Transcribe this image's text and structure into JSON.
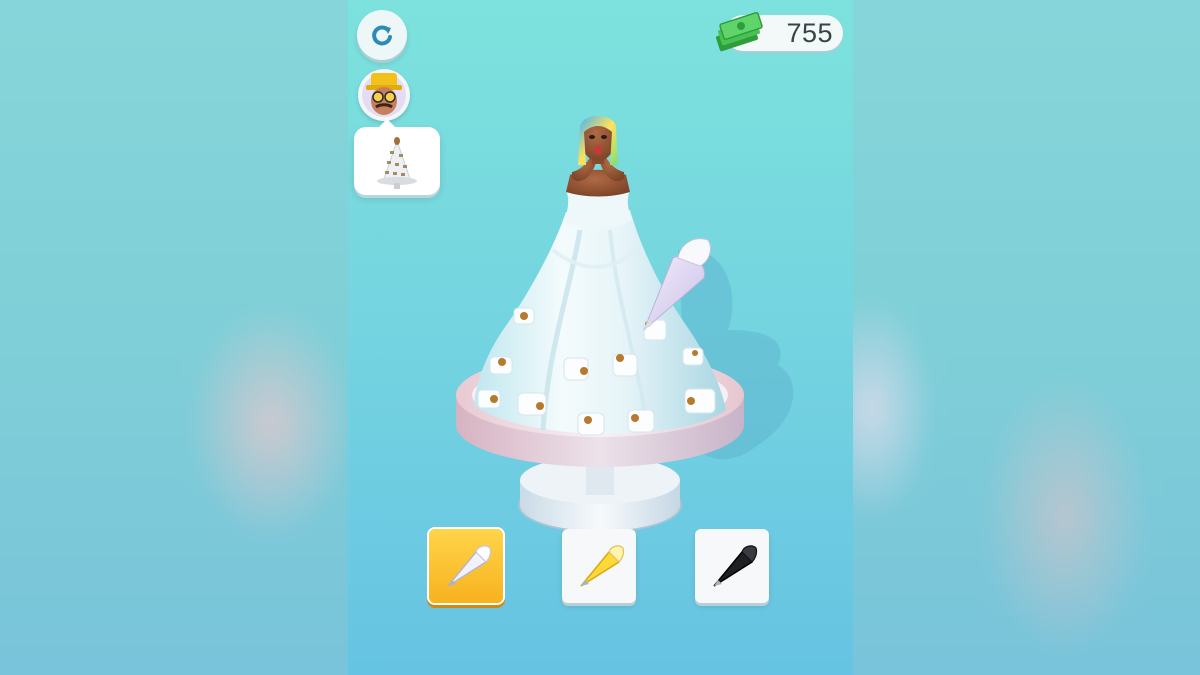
{
  "hud": {
    "money": "755",
    "restart_icon": "restart-icon",
    "cash_icon": "cash-stack-icon"
  },
  "customer": {
    "avatar_icon": "customer-avatar-icon",
    "order_icon": "tiered-cake-order-icon"
  },
  "tools": [
    {
      "name": "white-piping-bag",
      "icon": "piping-bag-white-icon",
      "selected": true
    },
    {
      "name": "yellow-piping-bag",
      "icon": "piping-bag-yellow-icon",
      "selected": false
    },
    {
      "name": "black-piping-bag",
      "icon": "piping-bag-black-icon",
      "selected": false
    }
  ],
  "colors": {
    "background_top": "#7de2dd",
    "background_bottom": "#66c3e3",
    "selected_tool": "#f7b21f",
    "money_pill": "#f3f8f9"
  }
}
